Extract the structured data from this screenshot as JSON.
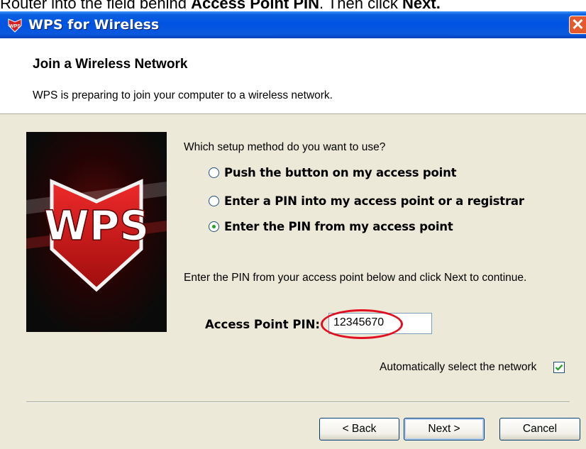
{
  "caption": {
    "pre": "Router into the field behind ",
    "bold1": "Access Point PIN",
    "mid": ". Then click ",
    "bold2": "Next."
  },
  "window": {
    "title": "WPS for Wireless",
    "titlebar_color": "#0054e3",
    "close_symbol": "✕"
  },
  "header": {
    "title": "Join a Wireless Network",
    "subtitle": "WPS is preparing to join your computer to a wireless network."
  },
  "banner": {
    "text": "WPS",
    "shield_color": "#c8102e"
  },
  "setup": {
    "question": "Which setup method do you want to use?",
    "options": [
      {
        "label": "Push the button on my access point",
        "selected": false
      },
      {
        "label": "Enter a PIN into my access point or a registrar",
        "selected": false
      },
      {
        "label": "Enter the PIN from my access point",
        "selected": true
      }
    ]
  },
  "pin": {
    "instruction": "Enter the PIN from your access point below and click Next to continue.",
    "label": "Access Point PIN:",
    "value": "12345670",
    "highlight_color": "#e01020"
  },
  "auto_select": {
    "label": "Automatically select the network",
    "checked": true
  },
  "buttons": {
    "back": "< Back",
    "next": "Next >",
    "cancel": "Cancel"
  }
}
